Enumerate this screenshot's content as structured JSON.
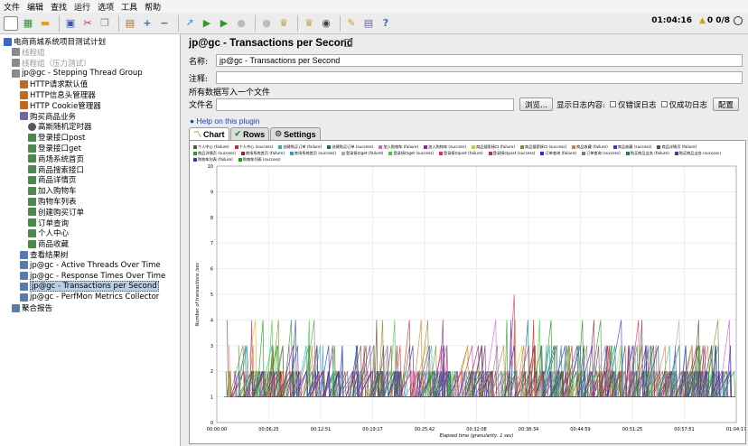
{
  "menu": [
    "文件",
    "编辑",
    "查找",
    "运行",
    "选项",
    "工具",
    "帮助"
  ],
  "toolbar_icons": [
    "new-icon",
    "templates-icon",
    "open-icon",
    "save-icon",
    "cut-icon",
    "copy-icon",
    "paste-icon",
    "expand-icon",
    "collapse-icon",
    "toggle-icon",
    "start-icon",
    "start-no-pause-icon",
    "stop-icon",
    "shutdown-icon",
    "clear-icon",
    "clear-all-icon",
    "search-icon",
    "reset-search-icon",
    "function-helper-icon",
    "help-icon"
  ],
  "status": {
    "time": "01:04:16",
    "warnings": "0",
    "threads": "0/8"
  },
  "tree": [
    {
      "label": "电商商城系统项目测试计划",
      "depth": 0,
      "icon": "test-plan-icon",
      "cn": true
    },
    {
      "label": "线程组",
      "depth": 1,
      "icon": "thread-group-icon",
      "cn": true,
      "disabled": true
    },
    {
      "label": "线程组（压力测试）",
      "depth": 1,
      "icon": "thread-group-icon",
      "cn": true,
      "disabled": true
    },
    {
      "label": "jp@gc - Stepping Thread Group",
      "depth": 1,
      "icon": "thread-group-icon"
    },
    {
      "label": "HTTP请求默认值",
      "depth": 2,
      "icon": "config-icon"
    },
    {
      "label": "HTTP信息头管理器",
      "depth": 2,
      "icon": "config-icon"
    },
    {
      "label": "HTTP Cookie管理器",
      "depth": 2,
      "icon": "config-icon"
    },
    {
      "label": "购买商品业务",
      "depth": 2,
      "icon": "controller-icon",
      "cn": true
    },
    {
      "label": "高斯随机定时器",
      "depth": 3,
      "icon": "timer-icon",
      "cn": true
    },
    {
      "label": "登录接口post",
      "depth": 3,
      "icon": "sampler-icon"
    },
    {
      "label": "登录接口get",
      "depth": 3,
      "icon": "sampler-icon"
    },
    {
      "label": "商场系统首页",
      "depth": 3,
      "icon": "sampler-icon",
      "cn": true
    },
    {
      "label": "商品搜索接口",
      "depth": 3,
      "icon": "sampler-icon",
      "cn": true
    },
    {
      "label": "商品详情页",
      "depth": 3,
      "icon": "sampler-icon",
      "cn": true
    },
    {
      "label": "加入购物车",
      "depth": 3,
      "icon": "sampler-icon",
      "cn": true
    },
    {
      "label": "购物车列表",
      "depth": 3,
      "icon": "sampler-icon",
      "cn": true
    },
    {
      "label": "创建购买订单",
      "depth": 3,
      "icon": "sampler-icon",
      "cn": true
    },
    {
      "label": "订单查询",
      "depth": 3,
      "icon": "sampler-icon",
      "cn": true
    },
    {
      "label": "个人中心",
      "depth": 3,
      "icon": "sampler-icon",
      "cn": true
    },
    {
      "label": "商品收藏",
      "depth": 3,
      "icon": "sampler-icon",
      "cn": true
    },
    {
      "label": "查看结果树",
      "depth": 2,
      "icon": "listener-icon",
      "cn": true
    },
    {
      "label": "jp@gc - Active Threads Over Time",
      "depth": 2,
      "icon": "listener-icon"
    },
    {
      "label": "jp@gc - Response Times Over Time",
      "depth": 2,
      "icon": "listener-icon"
    },
    {
      "label": "jp@gc - Transactions per Second",
      "depth": 2,
      "icon": "listener-icon",
      "selected": true
    },
    {
      "label": "jp@gc - PerfMon Metrics Collector",
      "depth": 2,
      "icon": "listener-icon"
    },
    {
      "label": "聚合报告",
      "depth": 1,
      "icon": "listener-icon",
      "cn": true
    }
  ],
  "panel": {
    "title": "jp@gc - Transactions per Second",
    "name_label": "名称:",
    "name_value": "jp@gc - Transactions per Second",
    "comment_label": "注释:",
    "comment_value": "",
    "section": "所有数据写入一个文件",
    "file_label": "文件名",
    "file_value": "",
    "browse": "浏览...",
    "log_label": "显示日志内容:",
    "errors_only": "仅错误日志",
    "success_only": "仅成功日志",
    "configure": "配置",
    "help": "Help on this plugin",
    "tabs": [
      "Chart",
      "Rows",
      "Settings"
    ]
  },
  "chart_data": {
    "type": "line",
    "ylabel": "Number of transactions /sec",
    "xlabel": "Elapsed time (granularity: 1 sec)",
    "ylim": [
      0,
      10
    ],
    "yticks": [
      "0",
      "1",
      "2",
      "3",
      "4",
      "5",
      "6",
      "7",
      "8",
      "9",
      "10"
    ],
    "xticks": [
      "00:00:00",
      "00:06:25",
      "00:12:51",
      "00:19:17",
      "00:25:42",
      "00:32:08",
      "00:38:34",
      "00:44:59",
      "00:51:25",
      "00:57:51",
      "01:04:17"
    ],
    "grid": true,
    "legend_position": "top",
    "series": [
      {
        "name": "个人中心 (failure)",
        "color": "#555555"
      },
      {
        "name": "个人中心 (success)",
        "color": "#cc2a2a"
      },
      {
        "name": "创建购买订单 (failure)",
        "color": "#2ab4b4"
      },
      {
        "name": "创建购买订单 (success)",
        "color": "#2a6a2a"
      },
      {
        "name": "加入购物车 (failure)",
        "color": "#d95ad9"
      },
      {
        "name": "加入购物车 (success)",
        "color": "#8a2a8a"
      },
      {
        "name": "商品搜索接口 (failure)",
        "color": "#c8c82a"
      },
      {
        "name": "商品搜索接口 (success)",
        "color": "#8a8a2a"
      },
      {
        "name": "商品收藏 (failure)",
        "color": "#e07a2a"
      },
      {
        "name": "商品收藏 (success)",
        "color": "#2a3ad0"
      },
      {
        "name": "商品详情页 (failure)",
        "color": "#6a4a2a"
      },
      {
        "name": "商品详情页 (success)",
        "color": "#2a9a2a"
      },
      {
        "name": "商场系统首页 (failure)",
        "color": "#9a2a2a"
      },
      {
        "name": "商场系统首页 (success)",
        "color": "#2aa0d0"
      },
      {
        "name": "登录接口get (failure)",
        "color": "#aaaaaa"
      },
      {
        "name": "登录接口get (success)",
        "color": "#3ad03a"
      },
      {
        "name": "登录接口post (failure)",
        "color": "#e02a70"
      },
      {
        "name": "登录接口post (success)",
        "color": "#d02a2a"
      },
      {
        "name": "订单查询 (failure)",
        "color": "#2a2ae0"
      },
      {
        "name": "订单查询 (success)",
        "color": "#7a7a7a"
      },
      {
        "name": "购买商品业务 (failure)",
        "color": "#1a7a7a"
      },
      {
        "name": "购买商品业务 (success)",
        "color": "#6a2aa0"
      },
      {
        "name": "购物车列表 (failure)",
        "color": "#3a3a8a"
      },
      {
        "name": "购物车列表 (success)",
        "color": "#1a9a1a"
      }
    ]
  }
}
